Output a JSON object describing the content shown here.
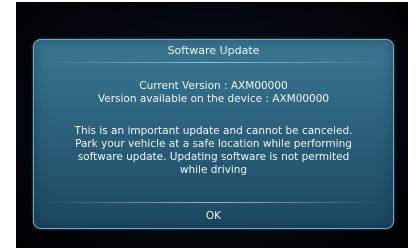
{
  "dialog": {
    "title": "Software Update",
    "current_version": "Current Version : AXM00000",
    "available_version": "Version available on the device : AXM00000",
    "message_lines": [
      "This is an important update and cannot be canceled.",
      "Park your vehicle at a safe location while performing",
      "software update. Updating software is not permited",
      "while driving"
    ],
    "ok_label": "OK"
  },
  "colors": {
    "dialog_bg": "#2f6782",
    "dialog_border": "#6fa8c4",
    "screen_bg": "#02050a",
    "text": "#f2f8fc"
  }
}
